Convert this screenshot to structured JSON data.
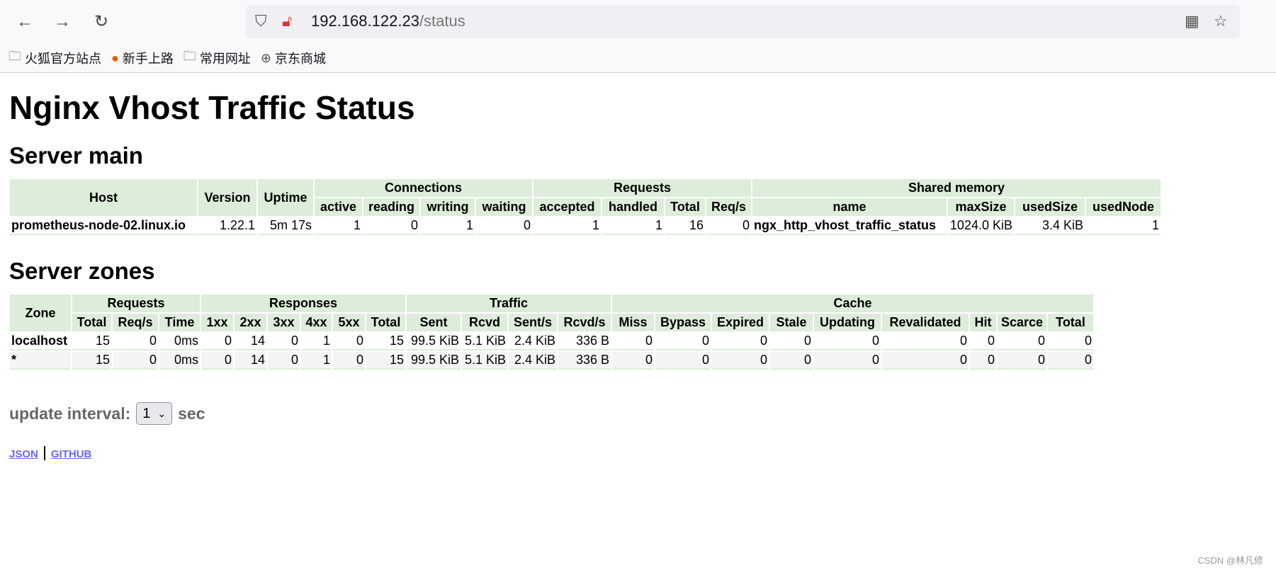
{
  "browser": {
    "url_host": "192.168.122.23",
    "url_path": "/status",
    "icons": [
      "back-icon",
      "forward-icon",
      "reload-icon",
      "shield-icon",
      "insecure-lock-icon",
      "qr-code-icon",
      "bookmark-star-icon"
    ],
    "bookmarks": [
      {
        "label": "火狐官方站点",
        "icon": "folder-icon"
      },
      {
        "label": "新手上路",
        "icon": "firefox-icon"
      },
      {
        "label": "常用网址",
        "icon": "folder-icon"
      },
      {
        "label": "京东商城",
        "icon": "globe-icon"
      }
    ]
  },
  "page": {
    "title": "Nginx Vhost Traffic Status",
    "server_main": {
      "heading": "Server main",
      "groups": {
        "host": "Host",
        "version": "Version",
        "uptime": "Uptime",
        "connections": "Connections",
        "requests": "Requests",
        "shared": "Shared memory"
      },
      "sub": [
        "active",
        "reading",
        "writing",
        "waiting",
        "accepted",
        "handled",
        "Total",
        "Req/s",
        "name",
        "maxSize",
        "usedSize",
        "usedNode"
      ],
      "row": [
        "prometheus-node-02.linux.io",
        "1.22.1",
        "5m 17s",
        "1",
        "0",
        "1",
        "0",
        "1",
        "1",
        "16",
        "0",
        "ngx_http_vhost_traffic_status",
        "1024.0 KiB",
        "3.4 KiB",
        "1"
      ]
    },
    "server_zones": {
      "heading": "Server zones",
      "groups": {
        "zone": "Zone",
        "requests": "Requests",
        "responses": "Responses",
        "traffic": "Traffic",
        "cache": "Cache"
      },
      "sub": [
        "Total",
        "Req/s",
        "Time",
        "1xx",
        "2xx",
        "3xx",
        "4xx",
        "5xx",
        "Total",
        "Sent",
        "Rcvd",
        "Sent/s",
        "Rcvd/s",
        "Miss",
        "Bypass",
        "Expired",
        "Stale",
        "Updating",
        "Revalidated",
        "Hit",
        "Scarce",
        "Total"
      ],
      "rows": [
        [
          "localhost",
          "15",
          "0",
          "0ms",
          "0",
          "14",
          "0",
          "1",
          "0",
          "15",
          "99.5 KiB",
          "5.1 KiB",
          "2.4 KiB",
          "336 B",
          "0",
          "0",
          "0",
          "0",
          "0",
          "0",
          "0",
          "0",
          "0"
        ],
        [
          "*",
          "15",
          "0",
          "0ms",
          "0",
          "14",
          "0",
          "1",
          "0",
          "15",
          "99.5 KiB",
          "5.1 KiB",
          "2.4 KiB",
          "336 B",
          "0",
          "0",
          "0",
          "0",
          "0",
          "0",
          "0",
          "0",
          "0"
        ]
      ]
    },
    "interval": {
      "label": "update interval:",
      "value": "1",
      "unit": "sec"
    },
    "links": {
      "json": "JSON",
      "github": "GITHUB"
    },
    "watermark": "CSDN @林凡修"
  },
  "colors": {
    "header_bg": "#dcedd9",
    "alt_row": "#f4f4f4",
    "link": "#6666ff"
  }
}
